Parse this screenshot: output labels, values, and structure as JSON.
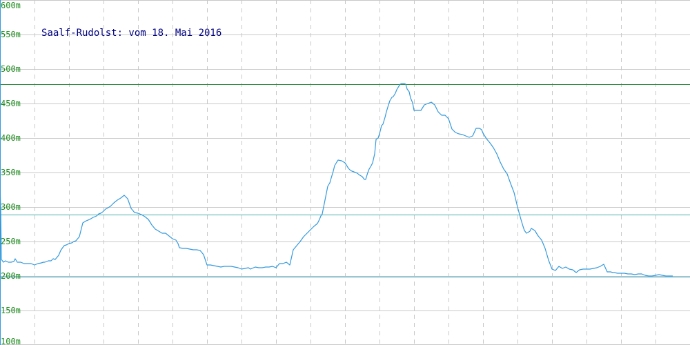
{
  "chart_data": {
    "type": "line",
    "title": "Saalf-Rudolst: vom 18. Mai 2016",
    "xlabel": "",
    "ylabel": "",
    "ylim": [
      100,
      600
    ],
    "y_ticks": [
      100,
      150,
      200,
      250,
      300,
      350,
      400,
      450,
      500,
      550,
      600
    ],
    "y_tick_labels": [
      "100m",
      "150m",
      "200m",
      "250m",
      "300m",
      "350m",
      "400m",
      "450m",
      "500m",
      "550m",
      "600m"
    ],
    "grid": true,
    "colors": {
      "line": "#3399dd",
      "tick_text": "#1e8c1e",
      "title_text": "#000080",
      "grid": "#c8c8c8",
      "ref_max": "#2e8b3e",
      "ref_mid": "#44aaaa",
      "ref_min": "#33aacc"
    },
    "reference_lines": [
      {
        "y": 478
      },
      {
        "y": 289
      },
      {
        "y": 199
      }
    ],
    "x": [
      0,
      1,
      2,
      5,
      8,
      12,
      16,
      20,
      22,
      25,
      30,
      35,
      40,
      45,
      50,
      55,
      60,
      63,
      65,
      70,
      74,
      77,
      80,
      85,
      88,
      90,
      93,
      96,
      100,
      104,
      107,
      110,
      115,
      120,
      125,
      130,
      135,
      140,
      143,
      146,
      149,
      152,
      153,
      155,
      160,
      165,
      170,
      175,
      180,
      185,
      190,
      195,
      200,
      205,
      210,
      215,
      220,
      225,
      230,
      235,
      240,
      245,
      250,
      255,
      258,
      260,
      265,
      270,
      275,
      280,
      285,
      290,
      295,
      300,
      305,
      310,
      315,
      320,
      325,
      330,
      335,
      340,
      345,
      350,
      355,
      360,
      363,
      365,
      370,
      375,
      380,
      385,
      390,
      395,
      400,
      405,
      410,
      415,
      420,
      425,
      430,
      435,
      440,
      445,
      450,
      455,
      460,
      463,
      465,
      467,
      470,
      473,
      475,
      478,
      480,
      483,
      485,
      488,
      490,
      495,
      500,
      505,
      508,
      510,
      513,
      515,
      518,
      520,
      525,
      528,
      530,
      533,
      535,
      538,
      540,
      543,
      545,
      548,
      550,
      553,
      555,
      558,
      560,
      563,
      565,
      568,
      570,
      573,
      575,
      578,
      580,
      583,
      585,
      588,
      590,
      593,
      595,
      598,
      600,
      605,
      610,
      615,
      620,
      625,
      630,
      635,
      640,
      645,
      650,
      655,
      660,
      665,
      670,
      675,
      680,
      685,
      690,
      693,
      695,
      698,
      700,
      705,
      710,
      715,
      720,
      725,
      730,
      735,
      740,
      745,
      750,
      755,
      758,
      760,
      763,
      765,
      768,
      770,
      775,
      780,
      785,
      790,
      795,
      800,
      805,
      810,
      815,
      820,
      825,
      830,
      835,
      840,
      845,
      850,
      855,
      860,
      865,
      870,
      875,
      880,
      885,
      888,
      890,
      895,
      900,
      905,
      910,
      915,
      920,
      925,
      930,
      935,
      940,
      945,
      950,
      955,
      960,
      965,
      970,
      975,
      980,
      985
    ],
    "y": [
      330,
      298,
      224,
      220,
      222,
      220,
      220,
      221,
      225,
      220,
      220,
      218,
      218,
      218,
      216,
      218,
      219,
      220,
      220,
      222,
      222,
      225,
      224,
      230,
      237,
      240,
      244,
      245,
      247,
      248,
      250,
      251,
      257,
      277,
      280,
      282,
      285,
      287,
      290,
      291,
      293,
      296,
      297,
      298,
      301,
      306,
      310,
      313,
      317,
      312,
      298,
      292,
      291,
      289,
      286,
      282,
      274,
      268,
      265,
      262,
      262,
      258,
      254,
      252,
      247,
      241,
      240,
      240,
      239,
      238,
      238,
      237,
      231,
      216,
      216,
      215,
      214,
      213,
      214,
      214,
      214,
      213,
      212,
      210,
      211,
      212,
      210,
      211,
      213,
      212,
      212,
      213,
      213,
      214,
      212,
      218,
      218,
      220,
      216,
      238,
      244,
      250,
      257,
      262,
      267,
      272,
      276,
      282,
      287,
      290,
      305,
      320,
      330,
      335,
      342,
      352,
      360,
      365,
      368,
      367,
      364,
      356,
      353,
      352,
      351,
      350,
      349,
      347,
      344,
      340,
      340,
      350,
      355,
      360,
      364,
      377,
      398,
      400,
      406,
      418,
      420,
      430,
      438,
      448,
      454,
      459,
      460,
      465,
      470,
      475,
      478,
      479,
      479,
      478,
      471,
      467,
      458,
      451,
      440,
      440,
      440,
      448,
      450,
      452,
      448,
      438,
      433,
      433,
      428,
      413,
      408,
      406,
      405,
      403,
      401,
      403,
      414,
      414,
      414,
      412,
      407,
      399,
      393,
      386,
      377,
      365,
      355,
      348,
      334,
      321,
      300,
      282,
      272,
      266,
      262,
      263,
      265,
      269,
      266,
      258,
      252,
      240,
      223,
      210,
      208,
      214,
      211,
      213,
      210,
      209,
      205,
      209,
      210,
      210,
      210,
      211,
      212,
      214,
      217,
      206,
      206,
      205,
      205,
      204,
      204,
      204,
      203,
      203,
      202,
      203,
      203,
      201,
      200,
      200,
      201,
      202,
      201,
      200,
      200,
      200
    ]
  }
}
